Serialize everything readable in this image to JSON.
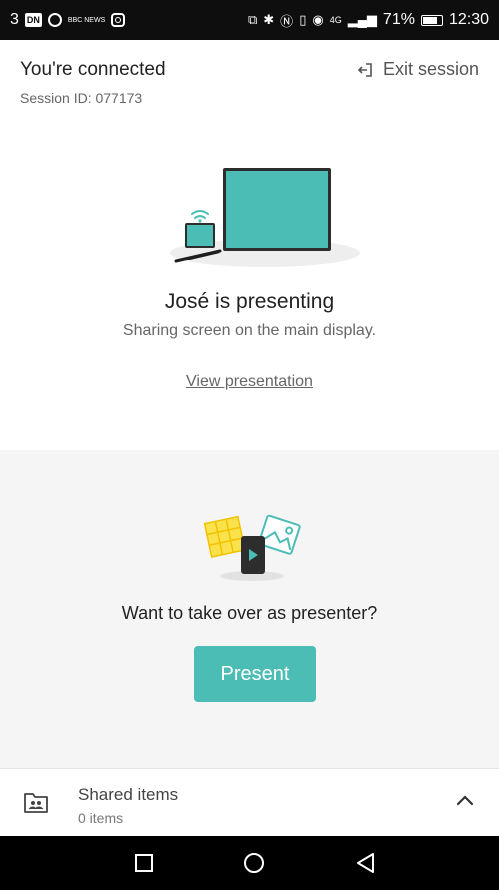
{
  "status_bar": {
    "carrier": "3",
    "dn_badge": "DN",
    "news_label": "BBC NEWS",
    "network": "4G",
    "battery": "71%",
    "time": "12:30",
    "icons": [
      "cast-icon",
      "bluetooth-icon",
      "nfc-icon",
      "vibrate-icon",
      "eye-icon",
      "signal-icon",
      "battery-icon"
    ]
  },
  "header": {
    "title": "You're connected",
    "session_id": "Session ID: 077173",
    "exit_label": "Exit session"
  },
  "presenting": {
    "title": "José is presenting",
    "subtitle": "Sharing screen on the main display.",
    "view_link": "View presentation"
  },
  "takeover": {
    "prompt": "Want to take over as presenter?",
    "button_label": "Present"
  },
  "shared_items": {
    "title": "Shared items",
    "count": "0 items"
  },
  "colors": {
    "accent": "#4bbdb4",
    "screen": "#4bbdb4",
    "panel_bg": "#f5f5f5",
    "status_bar": "#0e0e0e"
  },
  "nav": [
    "recents-button",
    "home-button",
    "back-button"
  ]
}
